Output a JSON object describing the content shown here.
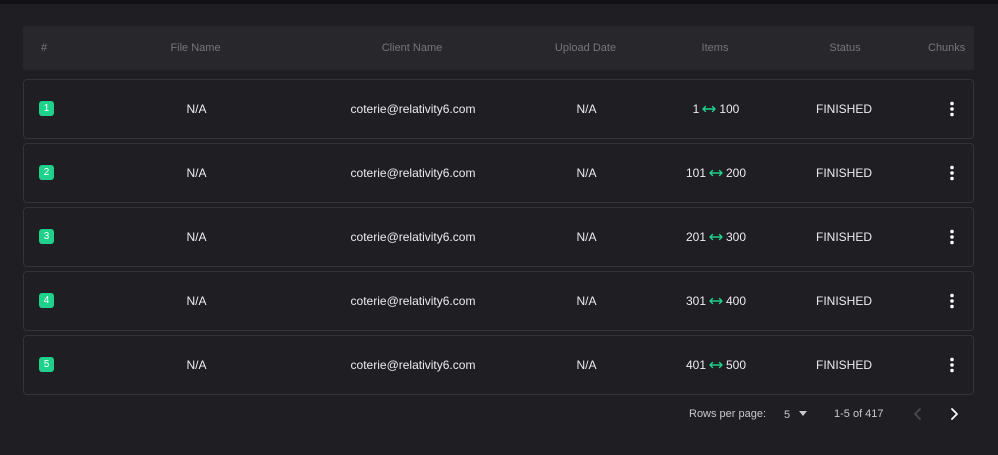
{
  "table": {
    "headers": {
      "index": "#",
      "file_name": "File Name",
      "client_name": "Client Name",
      "upload_date": "Upload Date",
      "items": "Items",
      "status": "Status",
      "chunks": "Chunks"
    },
    "rows": [
      {
        "index": "1",
        "file_name": "N/A",
        "client_name": "coterie@relativity6.com",
        "upload_date": "N/A",
        "items_from": "1",
        "items_to": "100",
        "status": "FINISHED"
      },
      {
        "index": "2",
        "file_name": "N/A",
        "client_name": "coterie@relativity6.com",
        "upload_date": "N/A",
        "items_from": "101",
        "items_to": "200",
        "status": "FINISHED"
      },
      {
        "index": "3",
        "file_name": "N/A",
        "client_name": "coterie@relativity6.com",
        "upload_date": "N/A",
        "items_from": "201",
        "items_to": "300",
        "status": "FINISHED"
      },
      {
        "index": "4",
        "file_name": "N/A",
        "client_name": "coterie@relativity6.com",
        "upload_date": "N/A",
        "items_from": "301",
        "items_to": "400",
        "status": "FINISHED"
      },
      {
        "index": "5",
        "file_name": "N/A",
        "client_name": "coterie@relativity6.com",
        "upload_date": "N/A",
        "items_from": "401",
        "items_to": "500",
        "status": "FINISHED"
      }
    ]
  },
  "pagination": {
    "rows_per_page_label": "Rows per page:",
    "rows_per_page_value": "5",
    "range_text": "1-5 of 417"
  },
  "colors": {
    "accent": "#1fd28b",
    "background": "#1f1e22",
    "header_bg": "#28272c"
  },
  "icons": {
    "range_arrow": "double-arrow-icon",
    "row_menu": "more-vertical-icon",
    "dropdown": "caret-down-icon",
    "prev": "chevron-left-icon",
    "next": "chevron-right-icon"
  }
}
